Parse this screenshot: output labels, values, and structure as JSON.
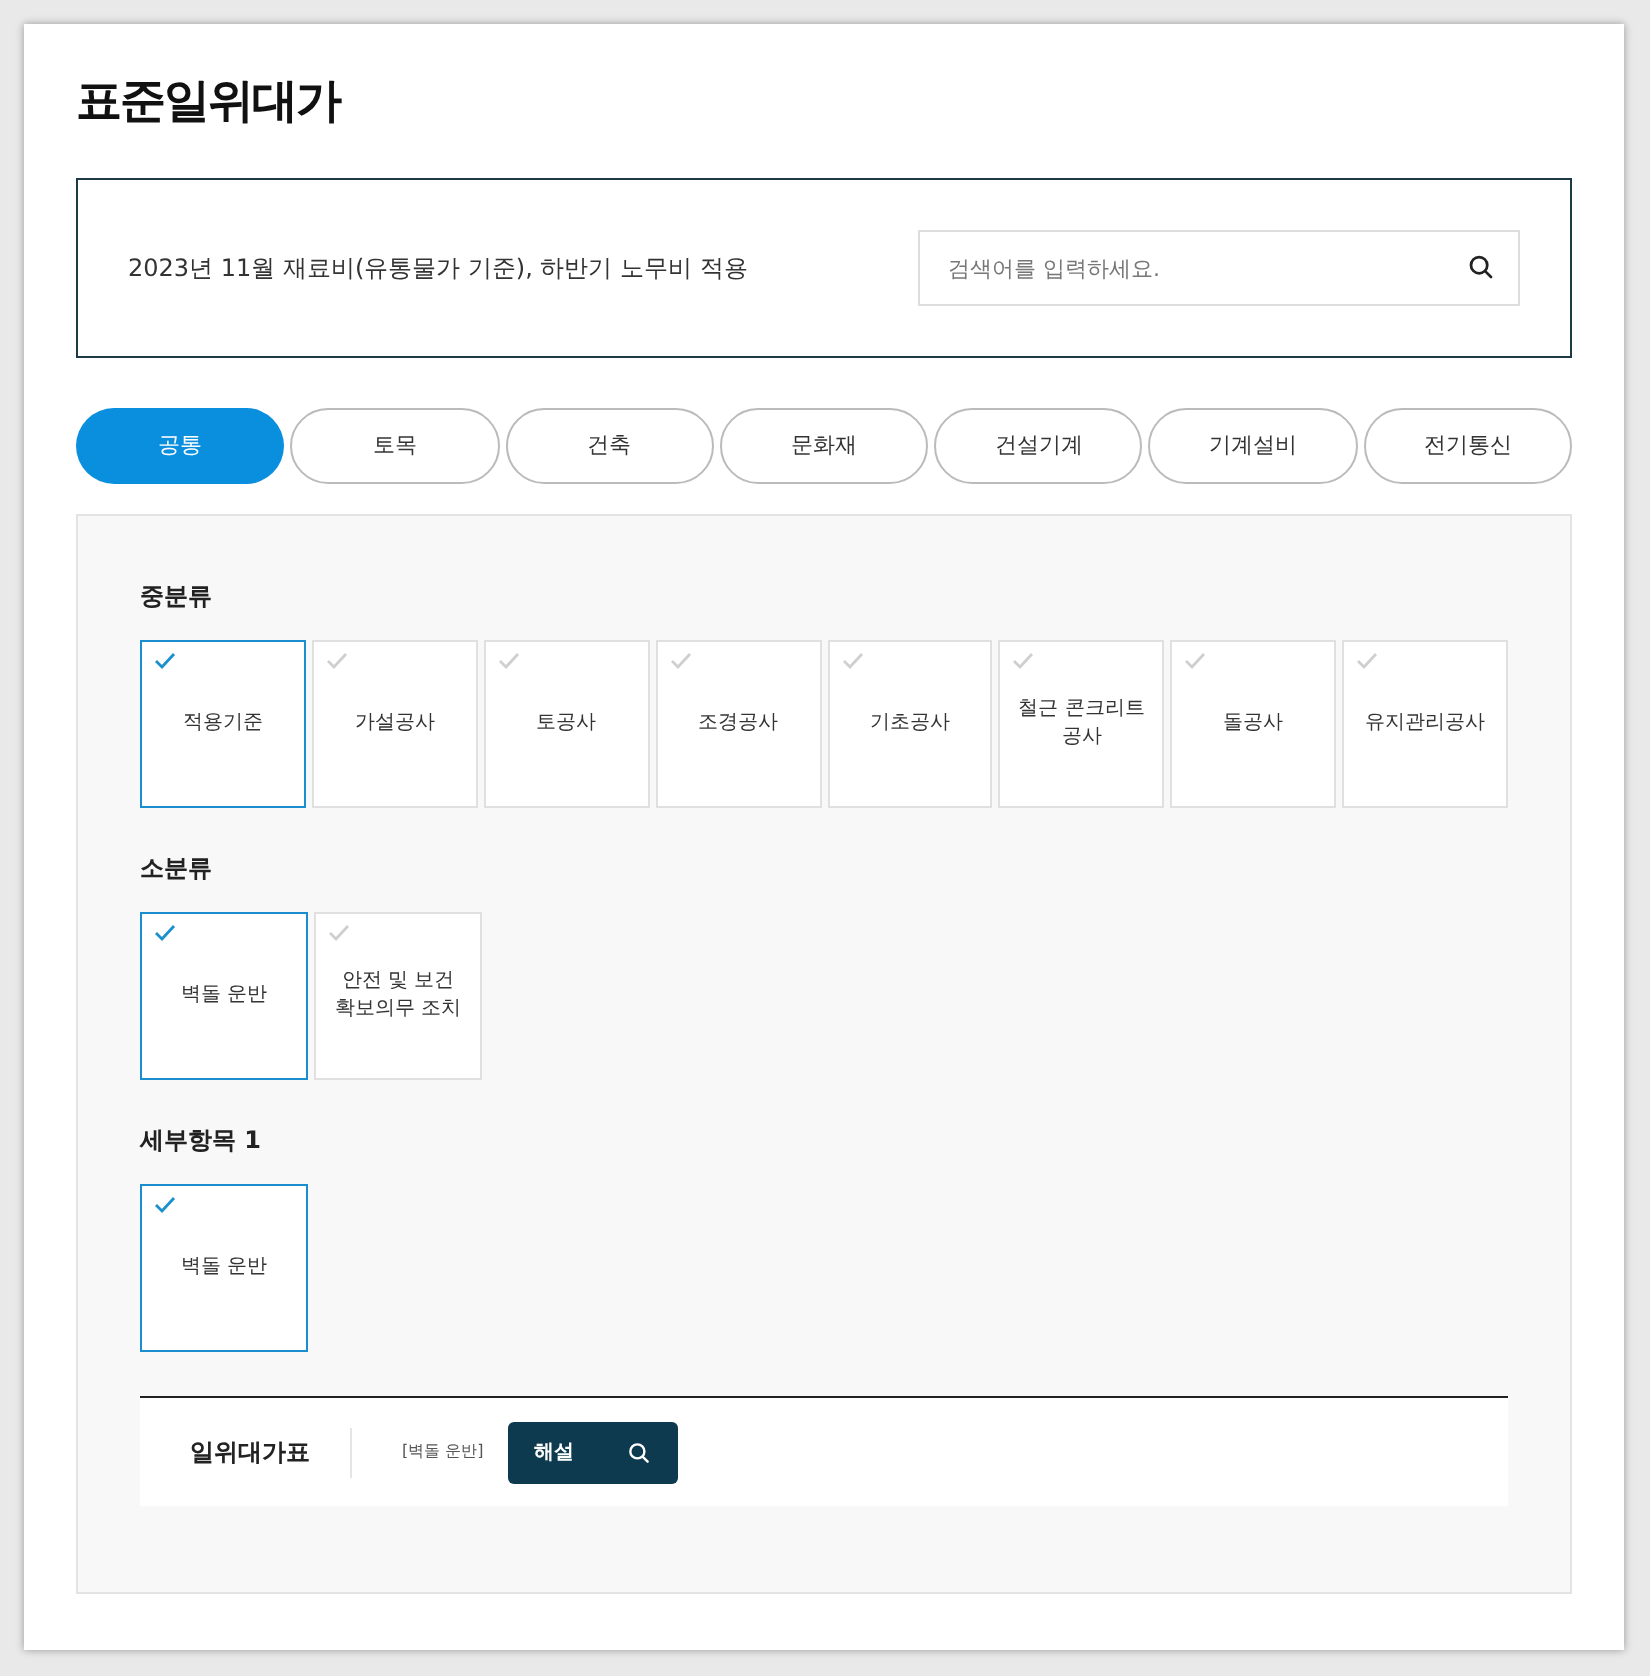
{
  "page_title": "표준일위대가",
  "notice": {
    "text": "2023년 11월 재료비(유통물가 기준), 하반기 노무비 적용",
    "search": {
      "placeholder": "검색어를 입력하세요."
    }
  },
  "tabs": [
    {
      "label": "공통",
      "selected": true
    },
    {
      "label": "토목",
      "selected": false
    },
    {
      "label": "건축",
      "selected": false
    },
    {
      "label": "문화재",
      "selected": false
    },
    {
      "label": "건설기계",
      "selected": false
    },
    {
      "label": "기계설비",
      "selected": false
    },
    {
      "label": "전기통신",
      "selected": false
    }
  ],
  "groups": [
    {
      "title": "중분류",
      "items": [
        {
          "label": "적용기준",
          "selected": true
        },
        {
          "label": "가설공사",
          "selected": false
        },
        {
          "label": "토공사",
          "selected": false
        },
        {
          "label": "조경공사",
          "selected": false
        },
        {
          "label": "기초공사",
          "selected": false
        },
        {
          "label": "철근 콘크리트\n공사",
          "selected": false
        },
        {
          "label": "돌공사",
          "selected": false
        },
        {
          "label": "유지관리공사",
          "selected": false
        }
      ]
    },
    {
      "title": "소분류",
      "items": [
        {
          "label": "벽돌 운반",
          "selected": true
        },
        {
          "label": "안전 및 보건\n확보의무 조치",
          "selected": false
        }
      ]
    },
    {
      "title": "세부항목 1",
      "items": [
        {
          "label": "벽돌 운반",
          "selected": true
        }
      ]
    }
  ],
  "result": {
    "title": "일위대가표",
    "item": "[벽돌 운반]",
    "button": "해설"
  }
}
